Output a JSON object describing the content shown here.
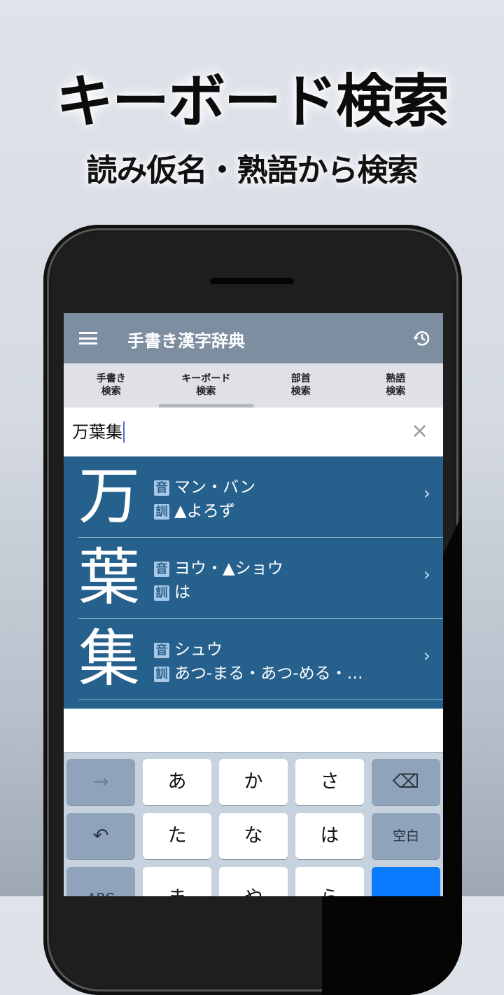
{
  "promo": {
    "headline": "キーボード検索",
    "subline": "読み仮名・熟語から検索"
  },
  "app": {
    "title": "手書き漢字辞典",
    "menu_icon": "hamburger-menu-icon",
    "history_icon": "history-icon",
    "colors": {
      "appbar": "#7d8ea0",
      "tabs": "#dfe1e7",
      "results": "#26608c",
      "badge": "#a9c8e5",
      "keyboard": "#c6d2de",
      "enter_key": "#0a7bff"
    }
  },
  "tabs": [
    {
      "line1": "手書き",
      "line2": "検索",
      "active": false
    },
    {
      "line1": "キーボード",
      "line2": "検索",
      "active": true
    },
    {
      "line1": "部首",
      "line2": "検索",
      "active": false
    },
    {
      "line1": "熟語",
      "line2": "検索",
      "active": false
    }
  ],
  "search": {
    "value": "万葉集",
    "clear_icon": "×"
  },
  "results": [
    {
      "kanji": "万",
      "on_label": "音",
      "on": "マン・バン",
      "kun_label": "訓",
      "kun": "▲よろず"
    },
    {
      "kanji": "葉",
      "on_label": "音",
      "on": "ヨウ・▲ショウ",
      "kun_label": "訓",
      "kun": "は"
    },
    {
      "kanji": "集",
      "on_label": "音",
      "on": "シュウ",
      "kun_label": "訓",
      "kun": "あつ-まる・あつ-める・…"
    }
  ],
  "chevron": "›",
  "keyboard": {
    "row1": [
      "→",
      "あ",
      "か",
      "さ",
      "⌫"
    ],
    "row2": [
      "↶",
      "た",
      "な",
      "は",
      "空白"
    ],
    "row3": [
      "ABC",
      "ま",
      "や",
      "ら",
      ""
    ]
  }
}
